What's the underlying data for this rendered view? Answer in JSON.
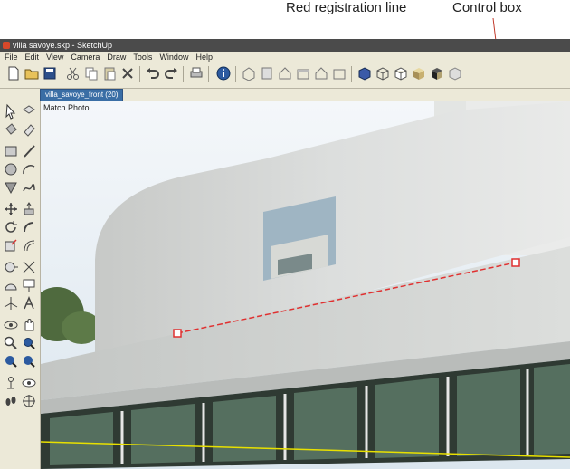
{
  "callouts": {
    "red_line": "Red registration line",
    "control_box": "Control box"
  },
  "window": {
    "title": "villa savoye.skp - SketchUp"
  },
  "menu": [
    "File",
    "Edit",
    "View",
    "Camera",
    "Draw",
    "Tools",
    "Window",
    "Help"
  ],
  "scene_tab": "villa_savoye_front (20)",
  "viewport": {
    "label": "Match Photo"
  },
  "colors": {
    "registration_line": "#e03030",
    "horizon_line": "#e8e000",
    "scene_tab_bg": "#3a6ea5"
  },
  "toolbar_icons": [
    "new-icon",
    "open-icon",
    "save-icon",
    "cut-icon",
    "copy-icon",
    "paste-icon",
    "erase-icon",
    "undo-icon",
    "redo-icon",
    "print-icon",
    "model-info-icon",
    "iso-view-icon",
    "top-view-icon",
    "front-view-icon",
    "right-view-icon",
    "back-view-icon",
    "left-view-icon",
    "xray-icon",
    "wireframe-icon",
    "hidden-line-icon",
    "shaded-icon",
    "shaded-textures-icon",
    "monochrome-icon"
  ],
  "left_tools": [
    "select-icon",
    "make-component-icon",
    "paint-bucket-icon",
    "eraser-icon",
    "rectangle-icon",
    "line-icon",
    "circle-icon",
    "arc-icon",
    "polygon-icon",
    "freehand-icon",
    "move-icon",
    "push-pull-icon",
    "rotate-icon",
    "follow-me-icon",
    "scale-icon",
    "offset-icon",
    "tape-measure-icon",
    "dimension-icon",
    "protractor-icon",
    "text-icon",
    "axes-icon",
    "3d-text-icon",
    "orbit-icon",
    "pan-icon",
    "zoom-icon",
    "zoom-window-icon",
    "previous-icon",
    "zoom-extents-icon",
    "position-camera-icon",
    "look-around-icon",
    "walk-icon",
    "section-plane-icon"
  ]
}
